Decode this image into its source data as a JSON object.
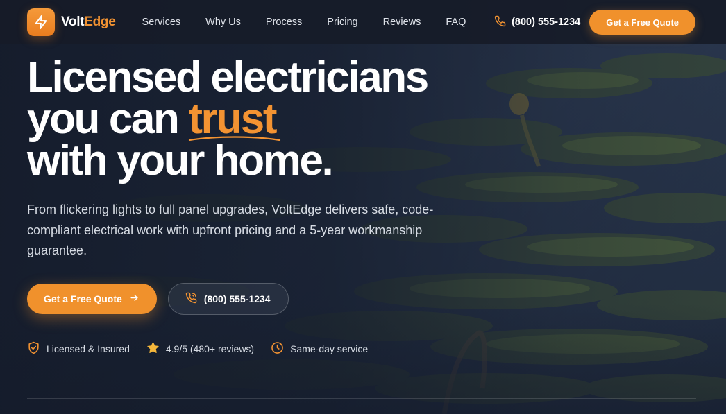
{
  "brand": {
    "name_part1": "Volt",
    "name_part2": "Edge",
    "accent_color": "#f0912c"
  },
  "nav": {
    "items": [
      "Services",
      "Why Us",
      "Process",
      "Pricing",
      "Reviews",
      "FAQ"
    ]
  },
  "header": {
    "phone": "(800) 555-1234",
    "cta_label": "Get a Free Quote"
  },
  "hero": {
    "headline_line1": "Licensed electricians",
    "headline_line2_prefix": "you can ",
    "headline_highlight": "trust",
    "headline_line3": "with your home",
    "headline_period": ".",
    "subhead": "From flickering lights to full panel upgrades, VoltEdge delivers safe, code-compliant electrical work with upfront pricing and a 5-year workmanship guarantee.",
    "primary_cta": "Get a Free Quote",
    "secondary_cta": "(800) 555-1234"
  },
  "trust": {
    "licensed": "Licensed & Insured",
    "rating": "4.9/5 (480+ reviews)",
    "same_day": "Same-day service"
  },
  "icons": {
    "logo": "lightning-bolt-icon",
    "phone": "phone-icon",
    "arrow": "arrow-right-icon",
    "shield": "shield-check-icon",
    "star": "star-icon",
    "clock": "clock-icon"
  }
}
